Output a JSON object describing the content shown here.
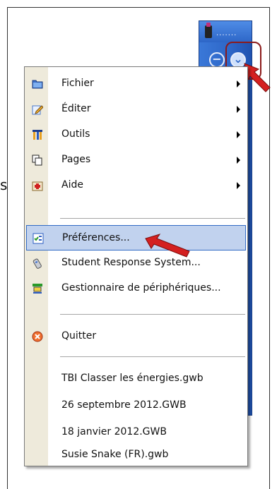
{
  "side_text": "s",
  "toolbar": {
    "dots_label": ".......",
    "minus_symbol": "−",
    "down_symbol": "⌄"
  },
  "menu": {
    "items": [
      {
        "label": "Fichier",
        "icon": "folder-icon",
        "submenu": true
      },
      {
        "label": "Éditer",
        "icon": "edit-pencil-icon",
        "submenu": true
      },
      {
        "label": "Outils",
        "icon": "tools-icon",
        "submenu": true
      },
      {
        "label": "Pages",
        "icon": "pages-icon",
        "submenu": true
      },
      {
        "label": "Aide",
        "icon": "first-aid-icon",
        "submenu": true
      },
      {
        "label": "Préférences...",
        "icon": "preferences-icon",
        "submenu": false,
        "selected": true
      },
      {
        "label": "Student Response System...",
        "icon": "response-remote-icon",
        "submenu": false
      },
      {
        "label": "Gestionnaire de périphériques...",
        "icon": "device-manager-icon",
        "submenu": false
      },
      {
        "label": "Quitter",
        "icon": "quit-icon",
        "submenu": false
      }
    ],
    "recent_files": [
      "TBI Classer les énergies.gwb",
      "26 septembre 2012.GWB",
      "18 janvier 2012.GWB",
      "Susie Snake (FR).gwb"
    ]
  },
  "colors": {
    "toolbar_blue": "#2d66c7",
    "highlight_red": "#8b1a1a",
    "arrow_red": "#d42020",
    "selection_fill": "#c1d2ee"
  }
}
